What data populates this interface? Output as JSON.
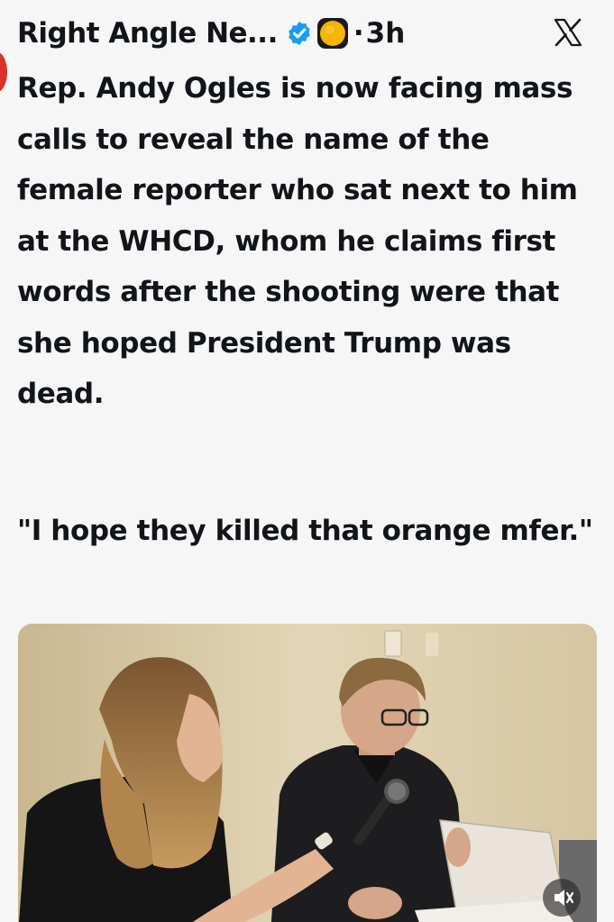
{
  "post": {
    "author_name": "Right Angle Ne...",
    "verified_badge_color": "#1d9bf0",
    "separator": "·",
    "timestamp": "3h",
    "platform_logo": "x-logo-icon",
    "paragraph_1": "Rep. Andy Ogles is now facing mass calls to reveal the name of the female reporter who sat next to him at the WHCD, whom he claims first words after the shooting were that she hoped President Trump was dead.",
    "paragraph_2": "\"I hope they killed that orange mfer.\"",
    "media": {
      "icons": [
        "microphone",
        "mute-icon"
      ]
    }
  },
  "colors": {
    "background": "#f6f6f7",
    "text": "#111418",
    "badge": "#1d9bf0",
    "emoji": "#f4b400"
  }
}
